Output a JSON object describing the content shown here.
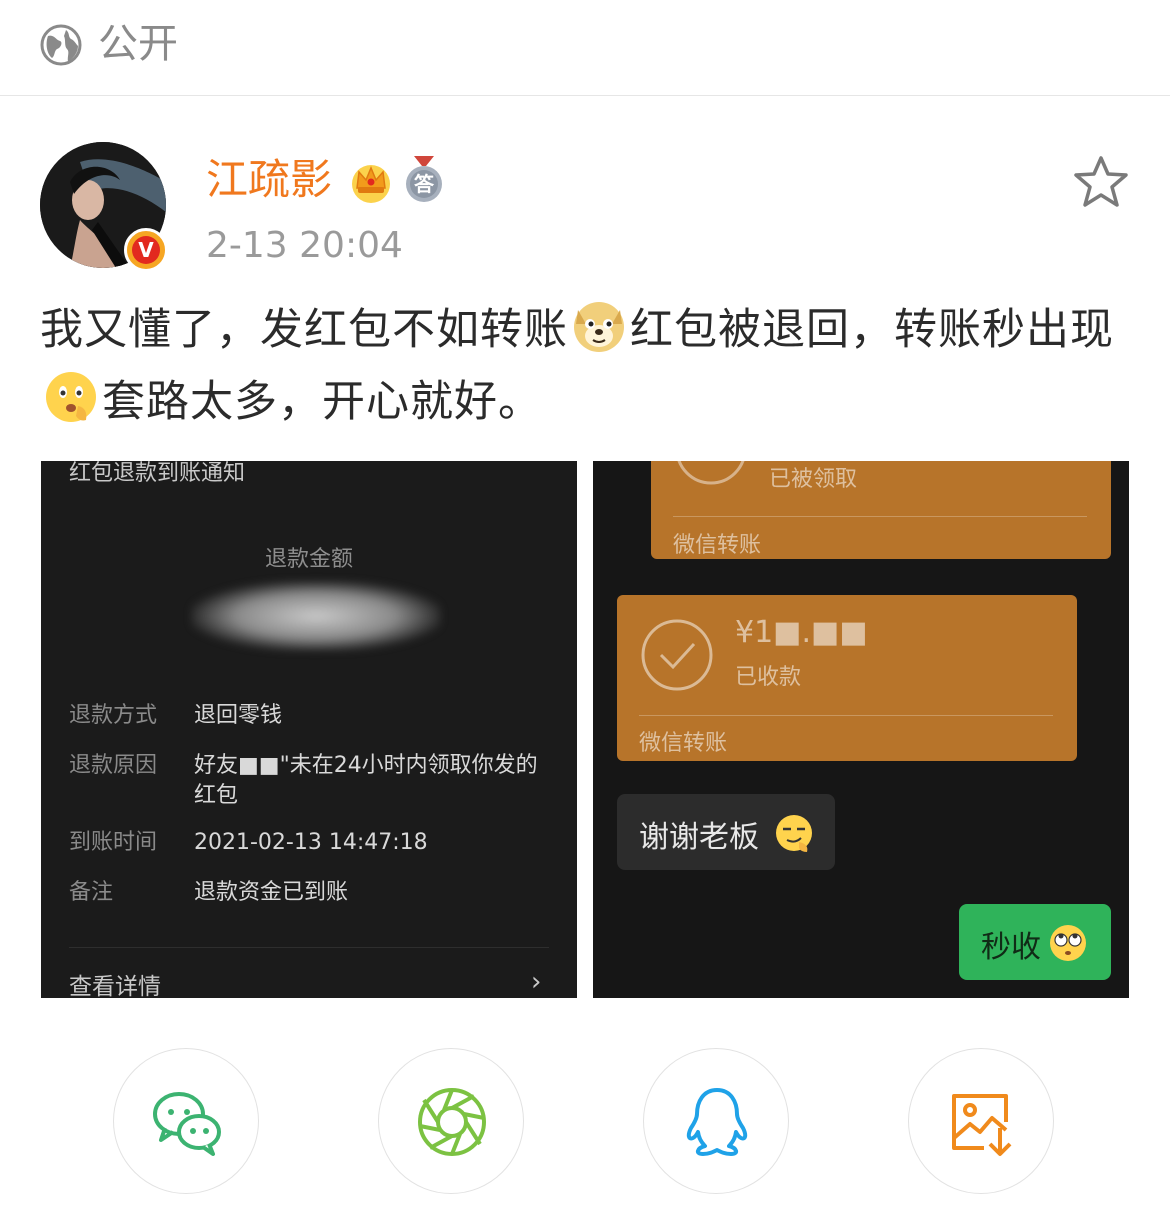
{
  "visibility": {
    "label": "公开",
    "icon": "globe-icon"
  },
  "author": {
    "name": "江疏影",
    "verified_badge": "V",
    "member_badge_icon": "crown-icon",
    "medal_text": "答",
    "timestamp": "2-13 20:04"
  },
  "post": {
    "text_1": "我又懂了，发红包不如转账",
    "text_2": "红包被退回，转账秒出现",
    "text_3": "套路太多，开心就好。",
    "emoji_1": "doge-emoji",
    "emoji_2": "thinking-emoji"
  },
  "image_left": {
    "title": "红包退款到账通知",
    "amount_label": "退款金额",
    "rows": [
      {
        "key": "退款方式",
        "value": "退回零钱"
      },
      {
        "key": "退款原因",
        "value": "好友■■\"未在24小时内领取你发的红包"
      },
      {
        "key": "到账时间",
        "value": "2021-02-13 14:47:18"
      },
      {
        "key": "备注",
        "value": "退款资金已到账"
      }
    ],
    "more_label": "查看详情"
  },
  "image_right": {
    "card1_status": "已被领取",
    "card1_footer": "微信转账",
    "card2_amount": "¥1■.■■",
    "card2_status": "已收款",
    "card2_footer": "微信转账",
    "bubble_gray": "谢谢老板",
    "bubble_green": "秒收"
  },
  "share": [
    {
      "name": "wechat-icon",
      "color": "#3cb371"
    },
    {
      "name": "moments-icon",
      "color": "#7cc242"
    },
    {
      "name": "qq-icon",
      "color": "#1fa2e8"
    },
    {
      "name": "save-image-icon",
      "color": "#f08a1c"
    }
  ],
  "colors": {
    "username": "#f0781e",
    "timestamp": "#9a9a9a",
    "card": "#b7742a",
    "green_bubble": "#2fb35a"
  }
}
